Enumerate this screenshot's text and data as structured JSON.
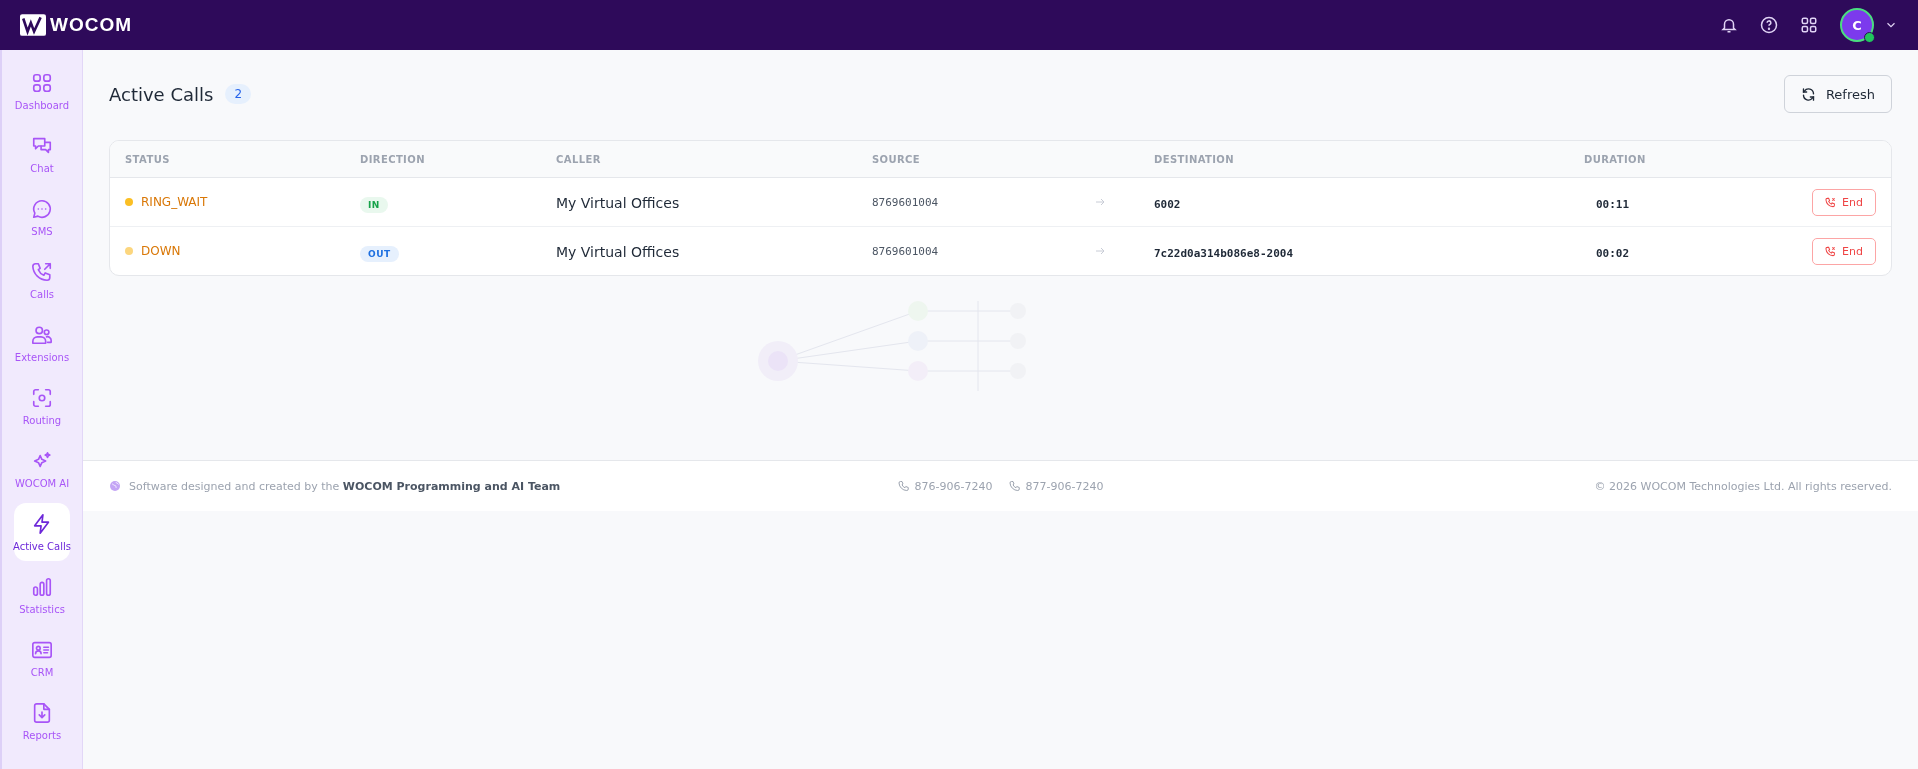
{
  "topbar": {
    "logo": "WOCOM",
    "avatar": {
      "initial": "C",
      "online": true
    }
  },
  "sidebar": {
    "items": [
      {
        "label": "Dashboard",
        "kind": "grid",
        "selected": false
      },
      {
        "label": "Chat",
        "kind": "chat",
        "selected": false
      },
      {
        "label": "SMS",
        "kind": "sms",
        "selected": false
      },
      {
        "label": "Calls",
        "kind": "calls",
        "selected": false
      },
      {
        "label": "Extensions",
        "kind": "users",
        "selected": false
      },
      {
        "label": "Routing",
        "kind": "routing",
        "selected": false
      },
      {
        "label": "WOCOM AI",
        "kind": "sparkle",
        "selected": false
      },
      {
        "label": "Active Calls",
        "kind": "bolt",
        "selected": true
      },
      {
        "label": "Statistics",
        "kind": "bars",
        "selected": false
      },
      {
        "label": "CRM",
        "kind": "card",
        "selected": false
      },
      {
        "label": "Reports",
        "kind": "report",
        "selected": false
      }
    ]
  },
  "page": {
    "title": "Active Calls",
    "count": "2",
    "refresh_button": "Refresh"
  },
  "table": {
    "columns": [
      "STATUS",
      "DIRECTION",
      "CALLER",
      "SOURCE",
      "DESTINATION",
      "DURATION"
    ],
    "rows": [
      {
        "status": "RING_WAIT",
        "color": "#fbbf24",
        "direction": "IN",
        "kind": "in",
        "caller": "My Virtual Offices",
        "source": "8769601004",
        "destination": "6002",
        "duration": "00:11",
        "action": "End"
      },
      {
        "status": "DOWN",
        "color": "#fcd67e",
        "direction": "OUT",
        "kind": "out",
        "caller": "My Virtual Offices",
        "source": "8769601004",
        "destination": "7c22d0a314b086e8-2004",
        "duration": "00:02",
        "action": "End"
      }
    ]
  },
  "footer": {
    "credit": "Software designed and created by the **WOCOM Programming and AI Team**",
    "phones": [
      "876-906-7240",
      "877-906-7240"
    ],
    "copyright": "© 2026 WOCOM Technologies Ltd. All rights reserved."
  }
}
